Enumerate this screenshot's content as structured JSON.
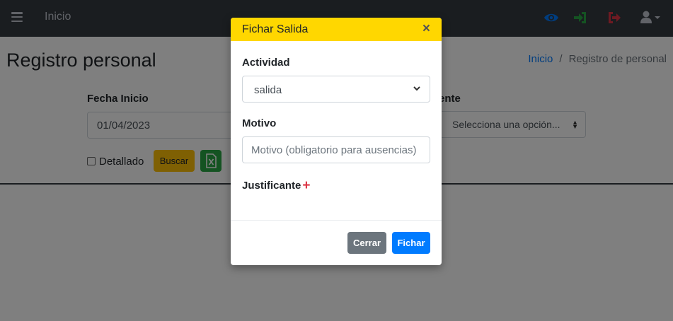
{
  "navbar": {
    "home_label": "Inicio",
    "icons": [
      "menu-icon",
      "eye-icon",
      "sign-in-icon",
      "sign-out-icon",
      "user-icon"
    ],
    "colors": {
      "bg": "#343a40",
      "eye": "#007bff",
      "sign_in": "#28a745",
      "sign_out": "#dc3545",
      "user": "#c2c7d0"
    }
  },
  "page": {
    "title": "Registro personal",
    "breadcrumb": {
      "home": "Inicio",
      "separator": "/",
      "current": "Registro de personal"
    }
  },
  "filters": {
    "fecha_inicio_label": "Fecha Inicio",
    "fecha_inicio_value": "01/04/2023",
    "right_label_partial": "ente",
    "right_select_value": "Selecciona una opción...",
    "detallado_label": "Detallado",
    "detallado_checked": false,
    "buscar_label": "Buscar",
    "excel_icon": "excel-icon"
  },
  "modal": {
    "title": "Fichar Salida",
    "close_label": "×",
    "actividad_label": "Actividad",
    "actividad_value": "salida",
    "motivo_label": "Motivo",
    "motivo_placeholder": "Motivo (obligatorio para ausencias)",
    "justificante_label": "Justificante",
    "add_label": "+",
    "cerrar_label": "Cerrar",
    "fichar_label": "Fichar",
    "header_color": "#ffd700"
  }
}
